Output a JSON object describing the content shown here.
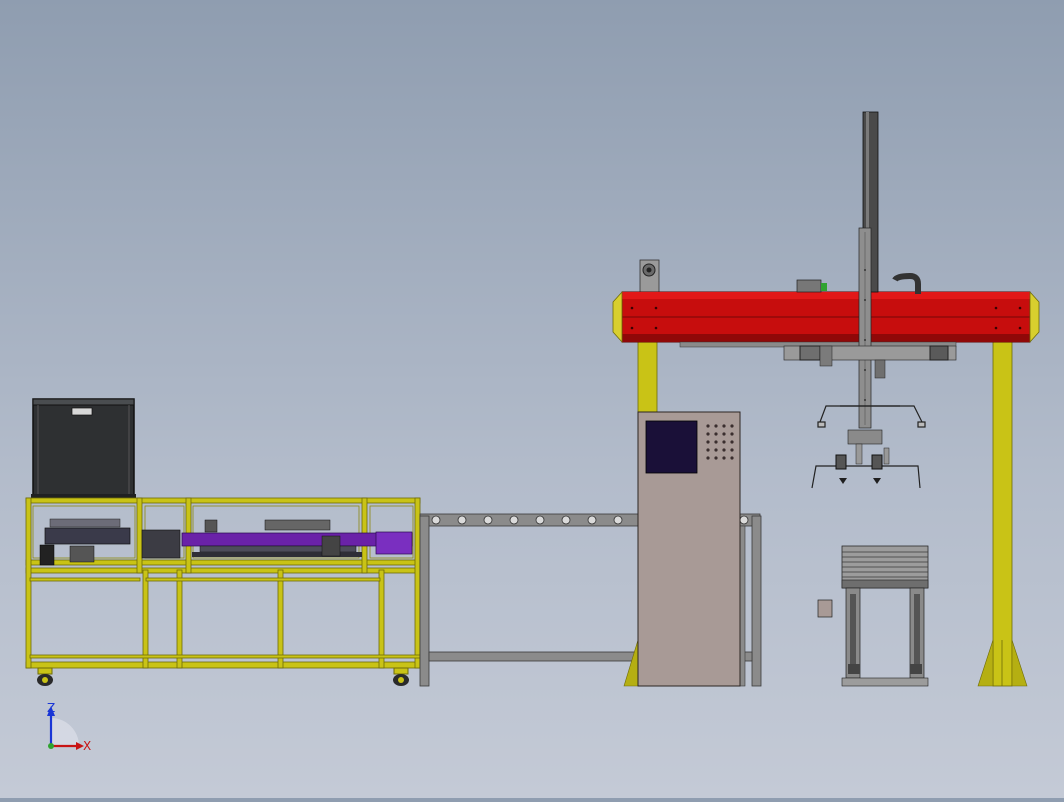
{
  "viewport": {
    "background_top": "#8f9db0",
    "background_bottom": "#c4cad6"
  },
  "colors": {
    "frame_yellow": "#c9c316",
    "frame_yellow_dark": "#8d8810",
    "gantry_red": "#c70d0d",
    "gantry_red_dark": "#8f0808",
    "gantry_end_yellow": "#d8cf2e",
    "conveyor_purple": "#6a22a8",
    "cabinet_taupe": "#a89a96",
    "screen_navy": "#1a1038",
    "steel_gray": "#7d7d7d",
    "dark_gray": "#3e3e3e"
  },
  "triad": {
    "z_label": "Z",
    "x_label": "X",
    "z_color": "#1a36d6",
    "x_color": "#c81414",
    "origin_color": "#2fa32f"
  },
  "components": {
    "top_box": "hopper-box",
    "feeder_frame": "feeder-frame",
    "roller_conveyor": "roller-conveyor",
    "control_cabinet": "control-cabinet",
    "gantry_robot": "gantry-robot",
    "pallet_stand": "pallet-stand"
  }
}
